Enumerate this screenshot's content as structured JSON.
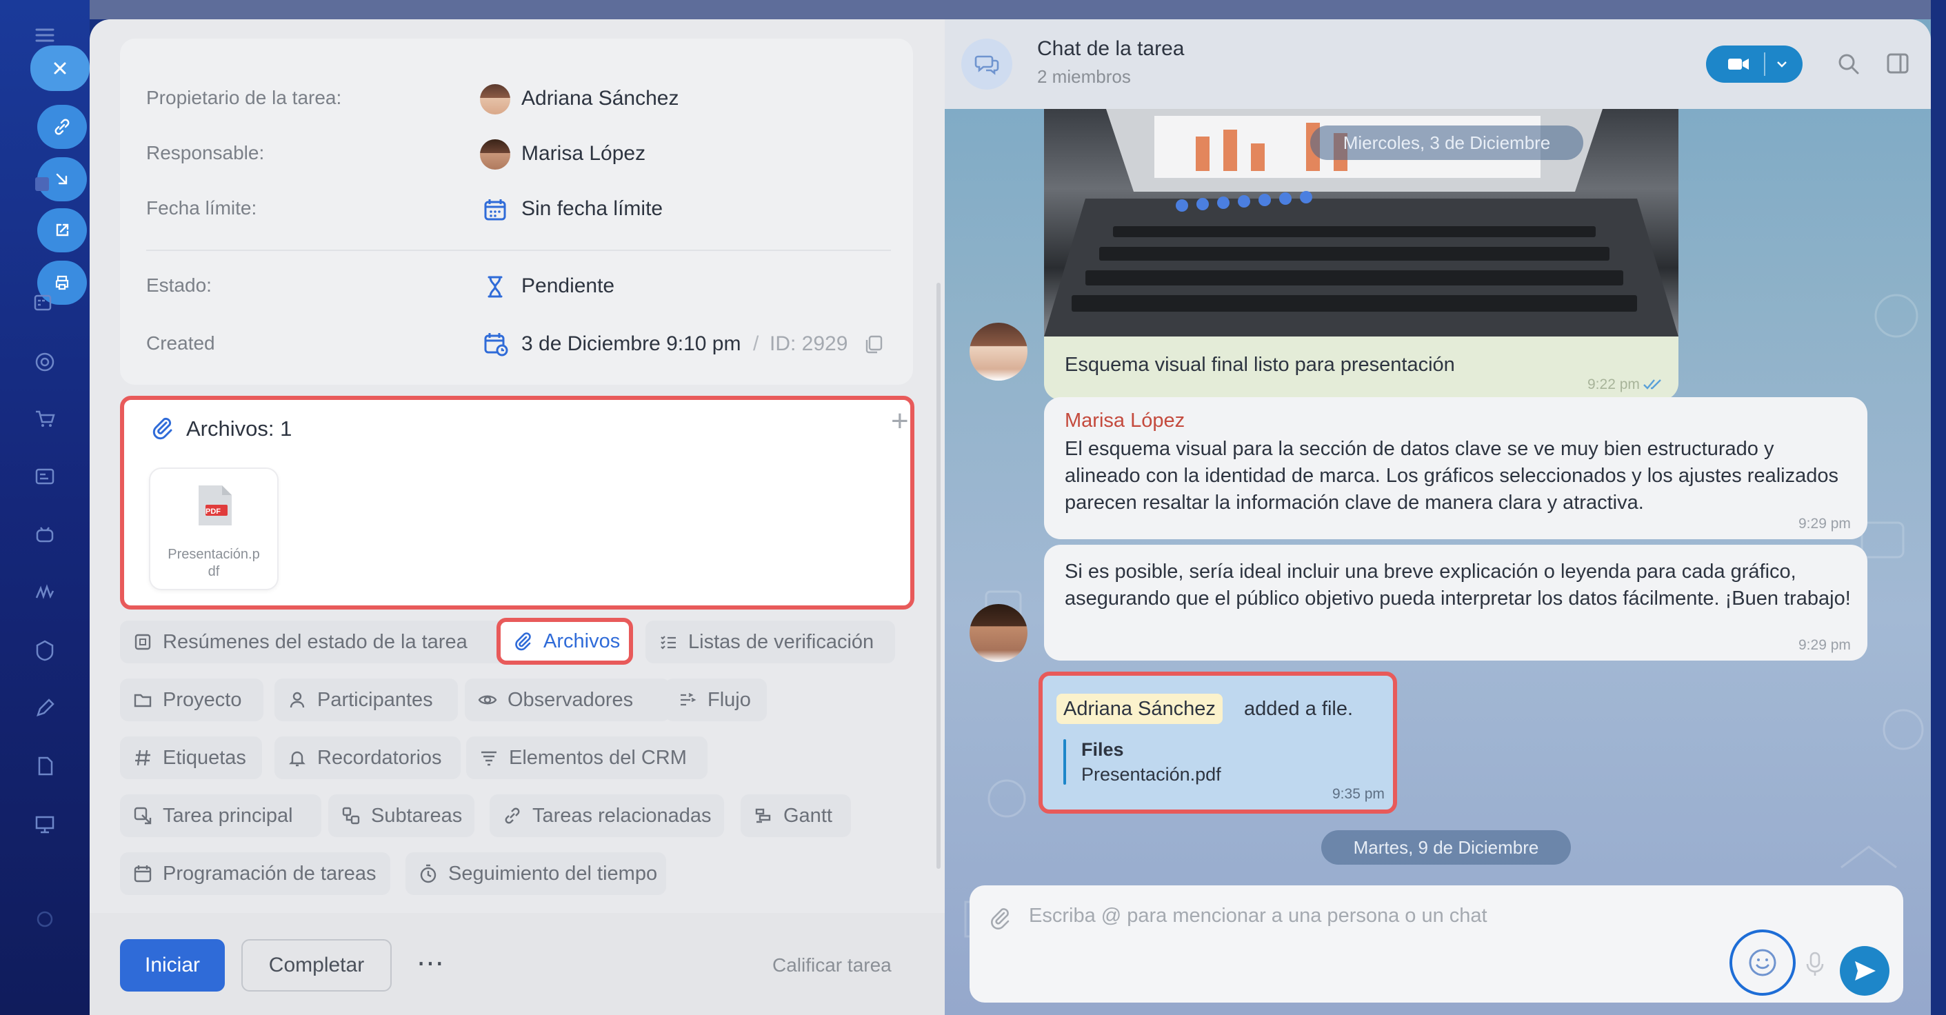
{
  "task_panel": {
    "owner_label": "Propietario de la tarea:",
    "owner_name": "Adriana Sánchez",
    "responsible_label": "Responsable:",
    "responsible_name": "Marisa López",
    "deadline_label": "Fecha límite:",
    "deadline_value": "Sin fecha límite",
    "status_label": "Estado:",
    "status_value": "Pendiente",
    "created_label": "Created",
    "created_value": "3 de Diciembre 9:10 pm",
    "id_separator": "/",
    "id_value": "ID: 2929"
  },
  "files": {
    "title": "Archivos: 1",
    "add_symbol": "+",
    "items": [
      {
        "name_line1": "Presentación.p",
        "name_line2": "df",
        "badge": "PDF"
      }
    ]
  },
  "chips": [
    {
      "label": "Resúmenes del estado de la tarea",
      "icon": "summary-icon",
      "active": false
    },
    {
      "label": "Archivos",
      "icon": "paperclip-icon",
      "active": true
    },
    {
      "label": "Listas de verificación",
      "icon": "checklist-icon",
      "active": false
    },
    {
      "label": "Proyecto",
      "icon": "folder-icon",
      "active": false
    },
    {
      "label": "Participantes",
      "icon": "user-icon",
      "active": false
    },
    {
      "label": "Observadores",
      "icon": "eye-icon",
      "active": false
    },
    {
      "label": "Flujo",
      "icon": "flow-icon",
      "active": false
    },
    {
      "label": "Etiquetas",
      "icon": "hash-icon",
      "active": false
    },
    {
      "label": "Recordatorios",
      "icon": "bell-icon",
      "active": false
    },
    {
      "label": "Elementos del CRM",
      "icon": "crm-icon",
      "active": false
    },
    {
      "label": "Tarea principal",
      "icon": "parent-task-icon",
      "active": false
    },
    {
      "label": "Subtareas",
      "icon": "subtasks-icon",
      "active": false
    },
    {
      "label": "Tareas relacionadas",
      "icon": "link-icon",
      "active": false
    },
    {
      "label": "Gantt",
      "icon": "gantt-icon",
      "active": false
    },
    {
      "label": "Programación de tareas",
      "icon": "calendar-icon",
      "active": false
    },
    {
      "label": "Seguimiento del tiempo",
      "icon": "stopwatch-icon",
      "active": false
    }
  ],
  "bottom_bar": {
    "start_label": "Iniciar",
    "complete_label": "Completar",
    "more_label": "⋯",
    "rate_label": "Calificar tarea"
  },
  "chat": {
    "title": "Chat de la tarea",
    "subtitle": "2 miembros",
    "date_top": "Miercoles, 3 de Diciembre",
    "date_bottom": "Martes, 9 de Diciembre",
    "messages": [
      {
        "text": "Esquema visual final listo para presentación",
        "time": "9:22 pm"
      },
      {
        "author": "Marisa López",
        "text": "El esquema visual para la sección de datos clave se ve muy bien estructurado y alineado con la identidad de marca. Los gráficos seleccionados y los ajustes realizados parecen resaltar la información clave de manera clara y atractiva.",
        "time": "9:29 pm"
      },
      {
        "text": "Si es posible, sería ideal incluir una breve explicación o leyenda para cada gráfico, asegurando que el público objetivo pueda interpretar los datos fácilmente. ¡Buen trabajo!",
        "time": "9:29 pm"
      }
    ],
    "system_message": {
      "user": "Adriana Sánchez",
      "action": "added a file.",
      "block_title": "Files",
      "block_file": "Presentación.pdf",
      "time": "9:35 pm"
    },
    "input_placeholder": "Escriba @ para mencionar a una persona o un chat"
  },
  "colors": {
    "primary": "#2f6bd8",
    "highlight_border": "#e85a5a",
    "author_red": "#c44a3d",
    "video_button": "#1d86c9"
  }
}
